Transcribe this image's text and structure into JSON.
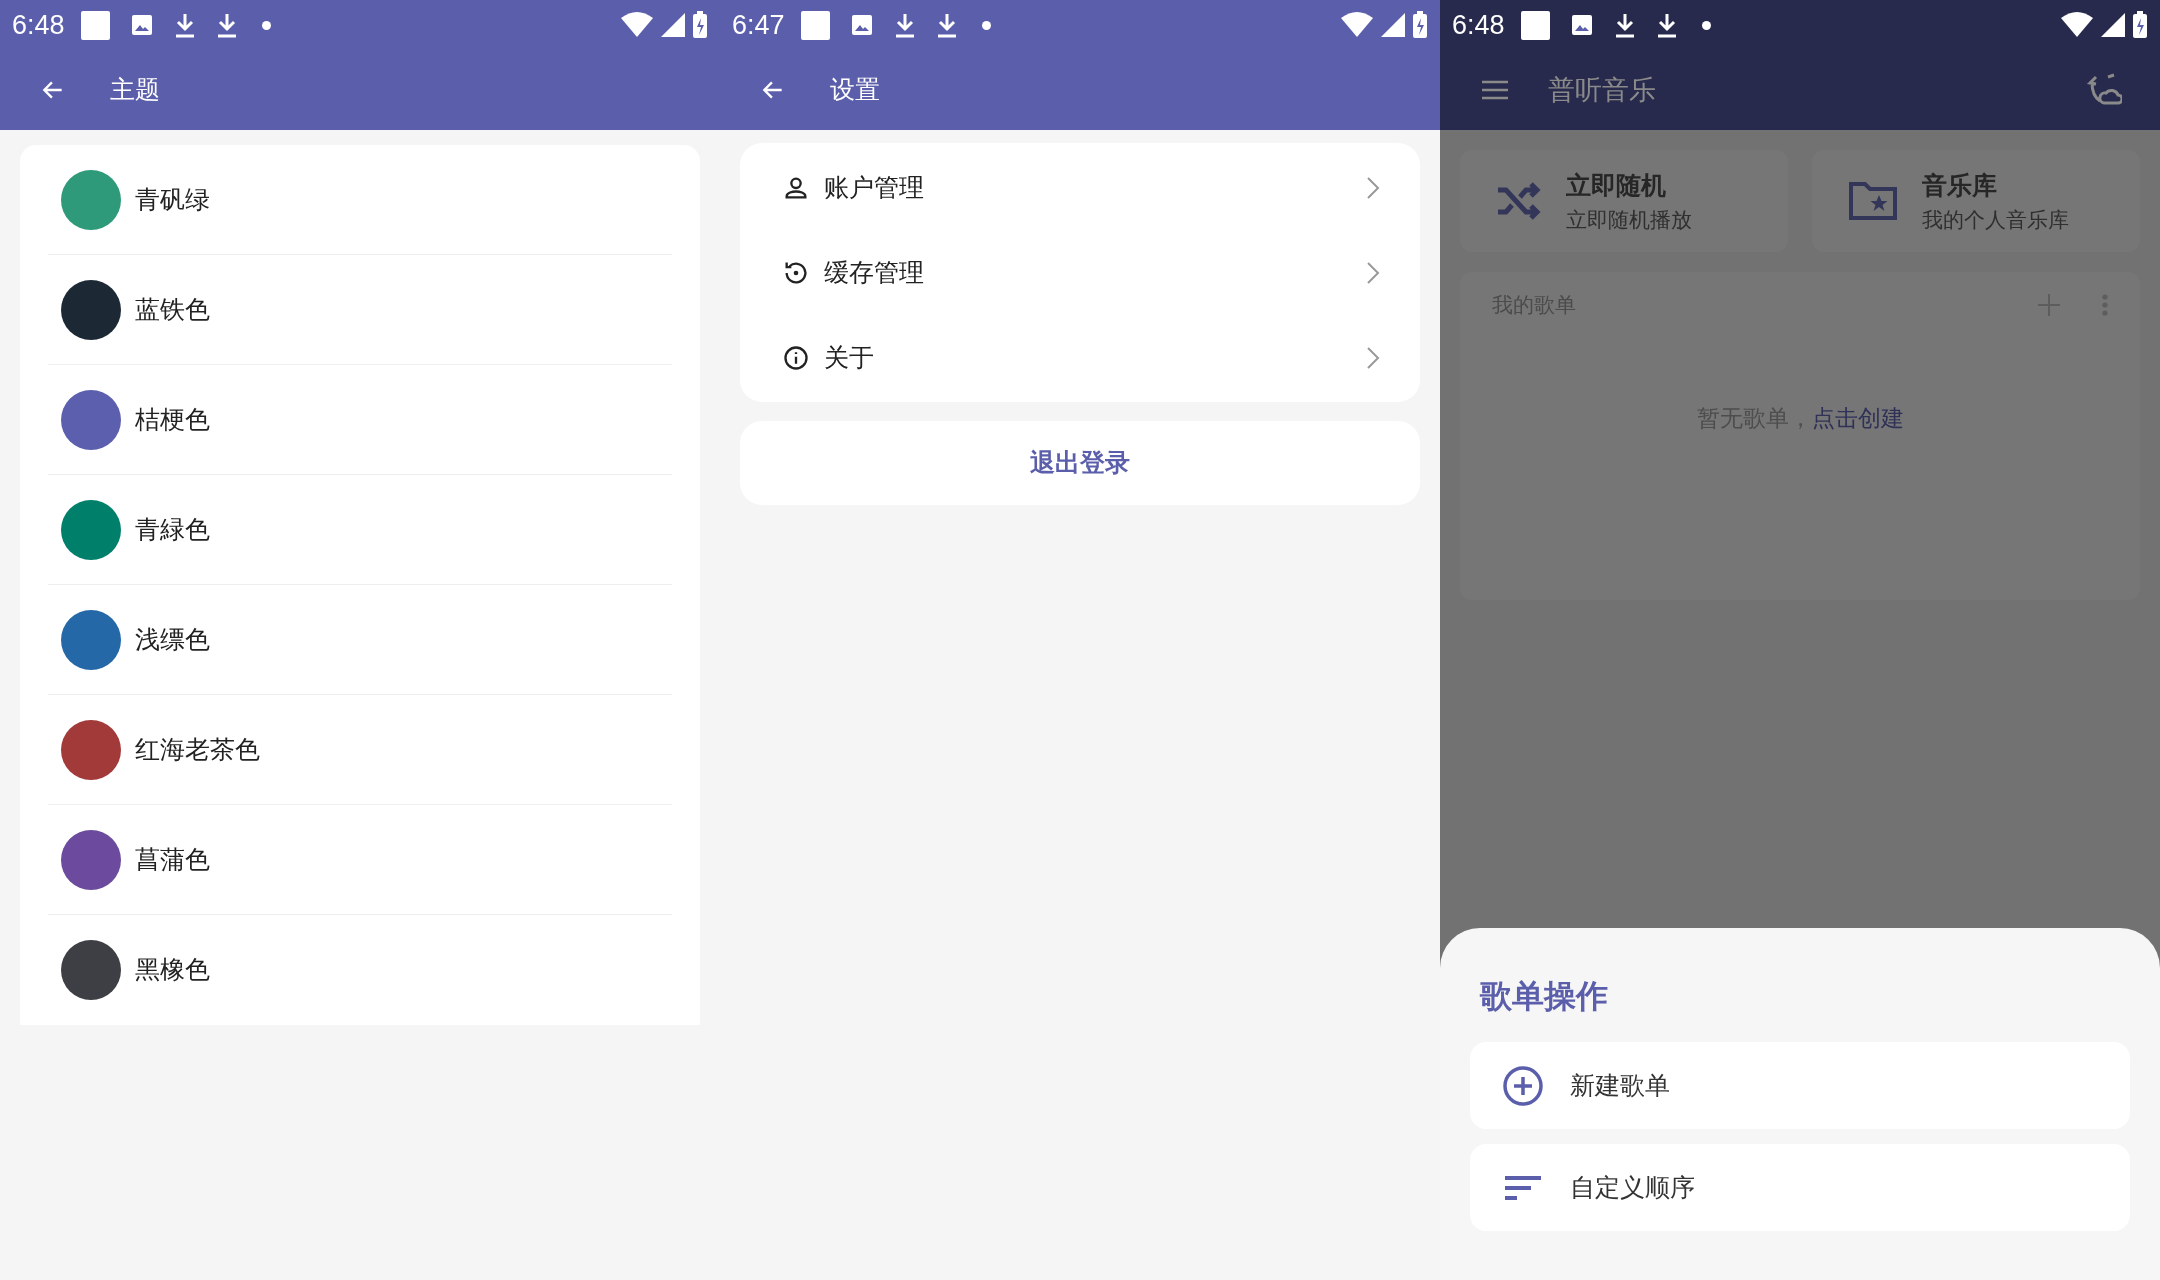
{
  "theme_screen": {
    "status_bar": {
      "time": "6:48"
    },
    "app_bar": {
      "title": "主题"
    },
    "themes": [
      {
        "name": "青矾绿",
        "color": "#2e9a7a"
      },
      {
        "name": "蓝铁色",
        "color": "#1c2935"
      },
      {
        "name": "桔梗色",
        "color": "#5c5fae"
      },
      {
        "name": "青緑色",
        "color": "#00806a"
      },
      {
        "name": "浅缥色",
        "color": "#2468a8"
      },
      {
        "name": "红海老茶色",
        "color": "#a33a3a"
      },
      {
        "name": "菖蒲色",
        "color": "#6c4b9e"
      },
      {
        "name": "黑橡色",
        "color": "#3e3f44"
      }
    ]
  },
  "settings_screen": {
    "status_bar": {
      "time": "6:47"
    },
    "app_bar": {
      "title": "设置"
    },
    "items": [
      {
        "label": "账户管理"
      },
      {
        "label": "缓存管理"
      },
      {
        "label": "关于"
      }
    ],
    "logout": "退出登录"
  },
  "home_screen": {
    "status_bar": {
      "time": "6:48"
    },
    "app_bar": {
      "title": "普听音乐"
    },
    "quick_cards": [
      {
        "title": "立即随机",
        "subtitle": "立即随机播放"
      },
      {
        "title": "音乐库",
        "subtitle": "我的个人音乐库"
      }
    ],
    "playlists": {
      "title": "我的歌单",
      "empty_text": "暂无歌单，",
      "create_link": "点击创建"
    },
    "sheet": {
      "title": "歌单操作",
      "actions": [
        {
          "label": "新建歌单"
        },
        {
          "label": "自定义顺序"
        }
      ]
    }
  }
}
